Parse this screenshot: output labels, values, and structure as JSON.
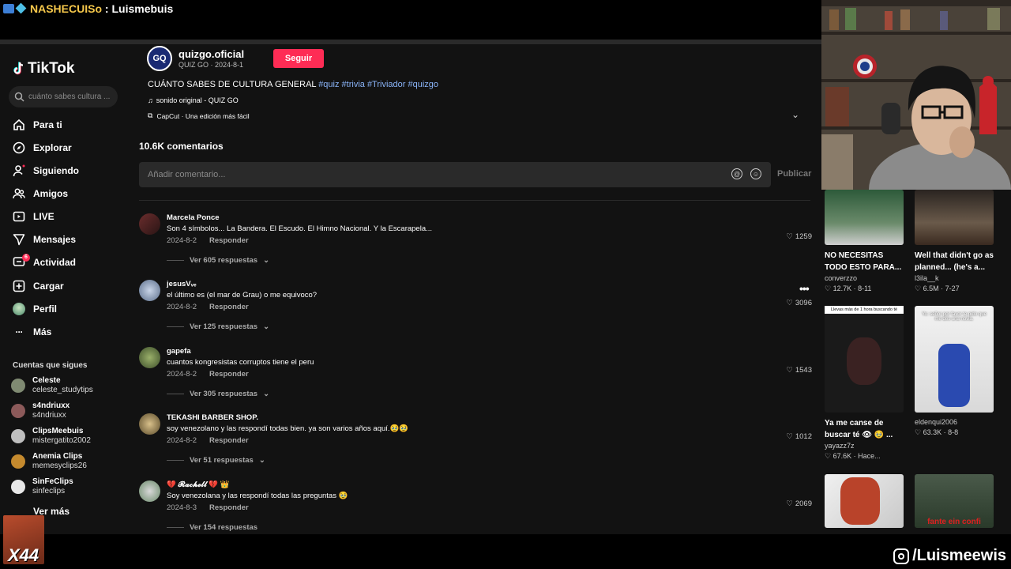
{
  "stream_title": {
    "source": "NASHECUISo",
    "separator": " : ",
    "user": "Luismebuis"
  },
  "sidebar": {
    "logo": "TikTok",
    "search_placeholder": "cuánto sabes cultura ...",
    "nav": [
      {
        "label": "Para ti",
        "icon": "home-icon"
      },
      {
        "label": "Explorar",
        "icon": "compass-icon"
      },
      {
        "label": "Siguiendo",
        "icon": "user-follow-icon"
      },
      {
        "label": "Amigos",
        "icon": "friends-icon"
      },
      {
        "label": "LIVE",
        "icon": "live-icon"
      },
      {
        "label": "Mensajes",
        "icon": "send-icon"
      },
      {
        "label": "Actividad",
        "icon": "message-icon",
        "badge": "6"
      },
      {
        "label": "Cargar",
        "icon": "upload-icon"
      },
      {
        "label": "Perfil",
        "icon": "profile-avatar"
      },
      {
        "label": "Más",
        "icon": "more-icon"
      }
    ],
    "following_header": "Cuentas que sigues",
    "following": [
      {
        "name": "Celeste",
        "handle": "celeste_studytips"
      },
      {
        "name": "s4ndriuxx",
        "handle": "s4ndriuxx"
      },
      {
        "name": "ClipsMeebuis",
        "handle": "mistergatito2002"
      },
      {
        "name": "Anemia Clips",
        "handle": "memesyclips26"
      },
      {
        "name": "SinFeClips",
        "handle": "sinfeclips"
      }
    ],
    "ver_mas": "Ver más"
  },
  "post": {
    "author_name": "quizgo.oficial",
    "author_meta": "QUIZ GO · 2024-8-1",
    "avatar_text": "GQ",
    "follow_label": "Seguir",
    "description": "CUÁNTO SABES DE CULTURA GENERAL ",
    "hashtags": "#quiz #trivia #Triviador #quizgo",
    "sound": "sonido original - QUIZ GO",
    "capcut": "CapCut · Una edición más fácil"
  },
  "comments_section": {
    "count": "10.6K comentarios",
    "placeholder": "Añadir comentario...",
    "publish": "Publicar",
    "reply_label": "Responder"
  },
  "comments": [
    {
      "user": "Marcela Ponce",
      "text": "Son 4 símbolos... La Bandera. El Escudo. El Himno Nacional. Y la Escarapela...",
      "date": "2024-8-2",
      "likes": "1259",
      "replies": "Ver 605 respuestas"
    },
    {
      "user": "jesusVᵥₑ",
      "text": "el último es (el mar de Grau) o me equivoco?",
      "date": "2024-8-2",
      "likes": "3096",
      "replies": "Ver 125 respuestas"
    },
    {
      "user": "gapefa",
      "text": "cuantos kongresistas corruptos tiene el peru",
      "date": "2024-8-2",
      "likes": "1543",
      "replies": "Ver 305 respuestas"
    },
    {
      "user": "TEKASHI BARBER SHOP.",
      "text": "soy venezolano y las respondí todas bien. ya son varios años aquí.🥹🥹",
      "date": "2024-8-2",
      "likes": "1012",
      "replies": "Ver 51 respuestas"
    },
    {
      "user": "💔 𝓡𝓪𝓬𝓱𝓮𝓵𝓵 💔 👑",
      "text": "Soy venezolana y las respondí todas las preguntas 🥹",
      "date": "2024-8-3",
      "likes": "2069",
      "replies": "Ver 154 respuestas"
    }
  ],
  "related": [
    {
      "title": "NO NECESITAS TODO ESTO PARA...",
      "user": "converzzo",
      "stats": "♡ 12.7K · 8-11"
    },
    {
      "title": "Well that didn't go as planned... (he's a...",
      "user": "l3ila__k",
      "stats": "♡ 6.5M · 7-27"
    },
    {
      "title": "Ya me canse de buscar té 👁 🥹 ...",
      "user": "yayazz7z",
      "stats": "♡ 67.6K · Hace...",
      "overlay": "Llevas más de 1 hora buscando té"
    },
    {
      "title": "",
      "user": "eldenqui2006",
      "stats": "♡ 63.3K · 8-8",
      "overlay": "Yo: señor por favor te pido que me des una novia."
    },
    {
      "title": "",
      "user": "",
      "stats": ""
    },
    {
      "title": "",
      "user": "",
      "stats": "",
      "overlay": "fante ein confi"
    }
  ],
  "overlay": {
    "instagram": "/Luismeewis",
    "emote_text": "X44"
  },
  "colors": {
    "accent": "#fe2c55",
    "hashtag": "#8ab4f8",
    "bg": "#121212"
  }
}
